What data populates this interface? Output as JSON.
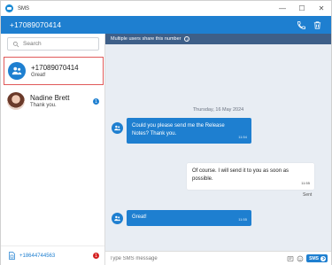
{
  "window": {
    "app_title": "SMS",
    "minimize": "—",
    "maximize": "☐",
    "close": "✕"
  },
  "header": {
    "title": "+17089070414"
  },
  "search": {
    "placeholder": "Search"
  },
  "contacts": [
    {
      "name": "+17089070414",
      "preview": "Great!",
      "selected": true
    },
    {
      "name": "Nadine Brett",
      "preview": "Thank you.",
      "unread": "1"
    }
  ],
  "sidebar_footer": {
    "number": "+18644744563",
    "badge": "1"
  },
  "info_bar": {
    "text": "Multiple users share this number",
    "icon": "i"
  },
  "conversation": {
    "date": "Thursday, 16 May 2024",
    "messages": [
      {
        "direction": "in",
        "lines": [
          "Could you please send me the Release",
          "Notes? Thank you."
        ],
        "time": "11:54"
      },
      {
        "direction": "out",
        "lines": [
          "Of course. I will send it to you as soon as",
          "possible."
        ],
        "time": "11:55",
        "status": "Sent"
      },
      {
        "direction": "in",
        "lines": [
          "Great!"
        ],
        "time": "11:55"
      }
    ]
  },
  "compose": {
    "placeholder": "Type SMS message",
    "send_label": "SMS"
  },
  "colors": {
    "accent": "#1e7fd0",
    "info_bar": "#3e5f88",
    "conversation_bg": "#e8edf3",
    "selection_border": "#e05a5a",
    "badge_red": "#d42020"
  }
}
